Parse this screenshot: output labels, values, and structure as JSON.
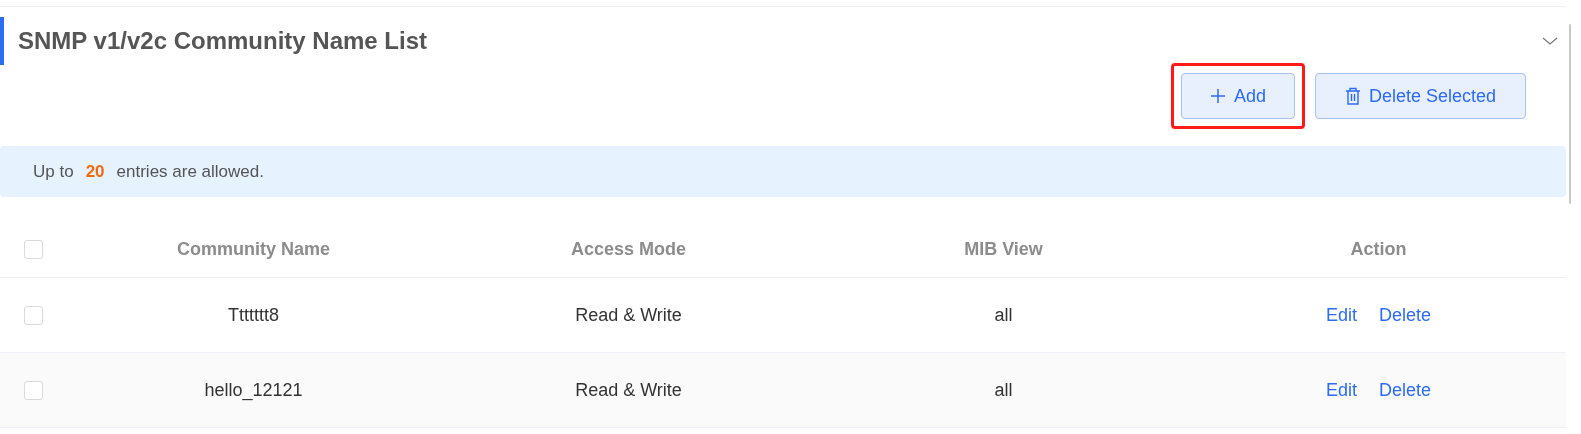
{
  "section": {
    "title": "SNMP v1/v2c Community Name List",
    "expanded": true
  },
  "buttons": [
    {
      "kind": "add",
      "label": "Add",
      "highlighted": true
    },
    {
      "kind": "delete",
      "label": "Delete Selected",
      "highlighted": false
    }
  ],
  "notice": {
    "before": "Up to",
    "count": "20",
    "after": "entries are allowed."
  },
  "table": {
    "select_all": {
      "checked": false
    },
    "columns": [
      "Community Name",
      "Access Mode",
      "MIB View",
      "Action"
    ],
    "rows": [
      {
        "checked": false,
        "cells": [
          "Ttttttt8",
          "Read & Write",
          "all"
        ],
        "actions": [
          "Edit",
          "Delete"
        ]
      },
      {
        "checked": false,
        "cells": [
          "hello_12121",
          "Read & Write",
          "all"
        ],
        "actions": [
          "Edit",
          "Delete"
        ]
      }
    ]
  }
}
